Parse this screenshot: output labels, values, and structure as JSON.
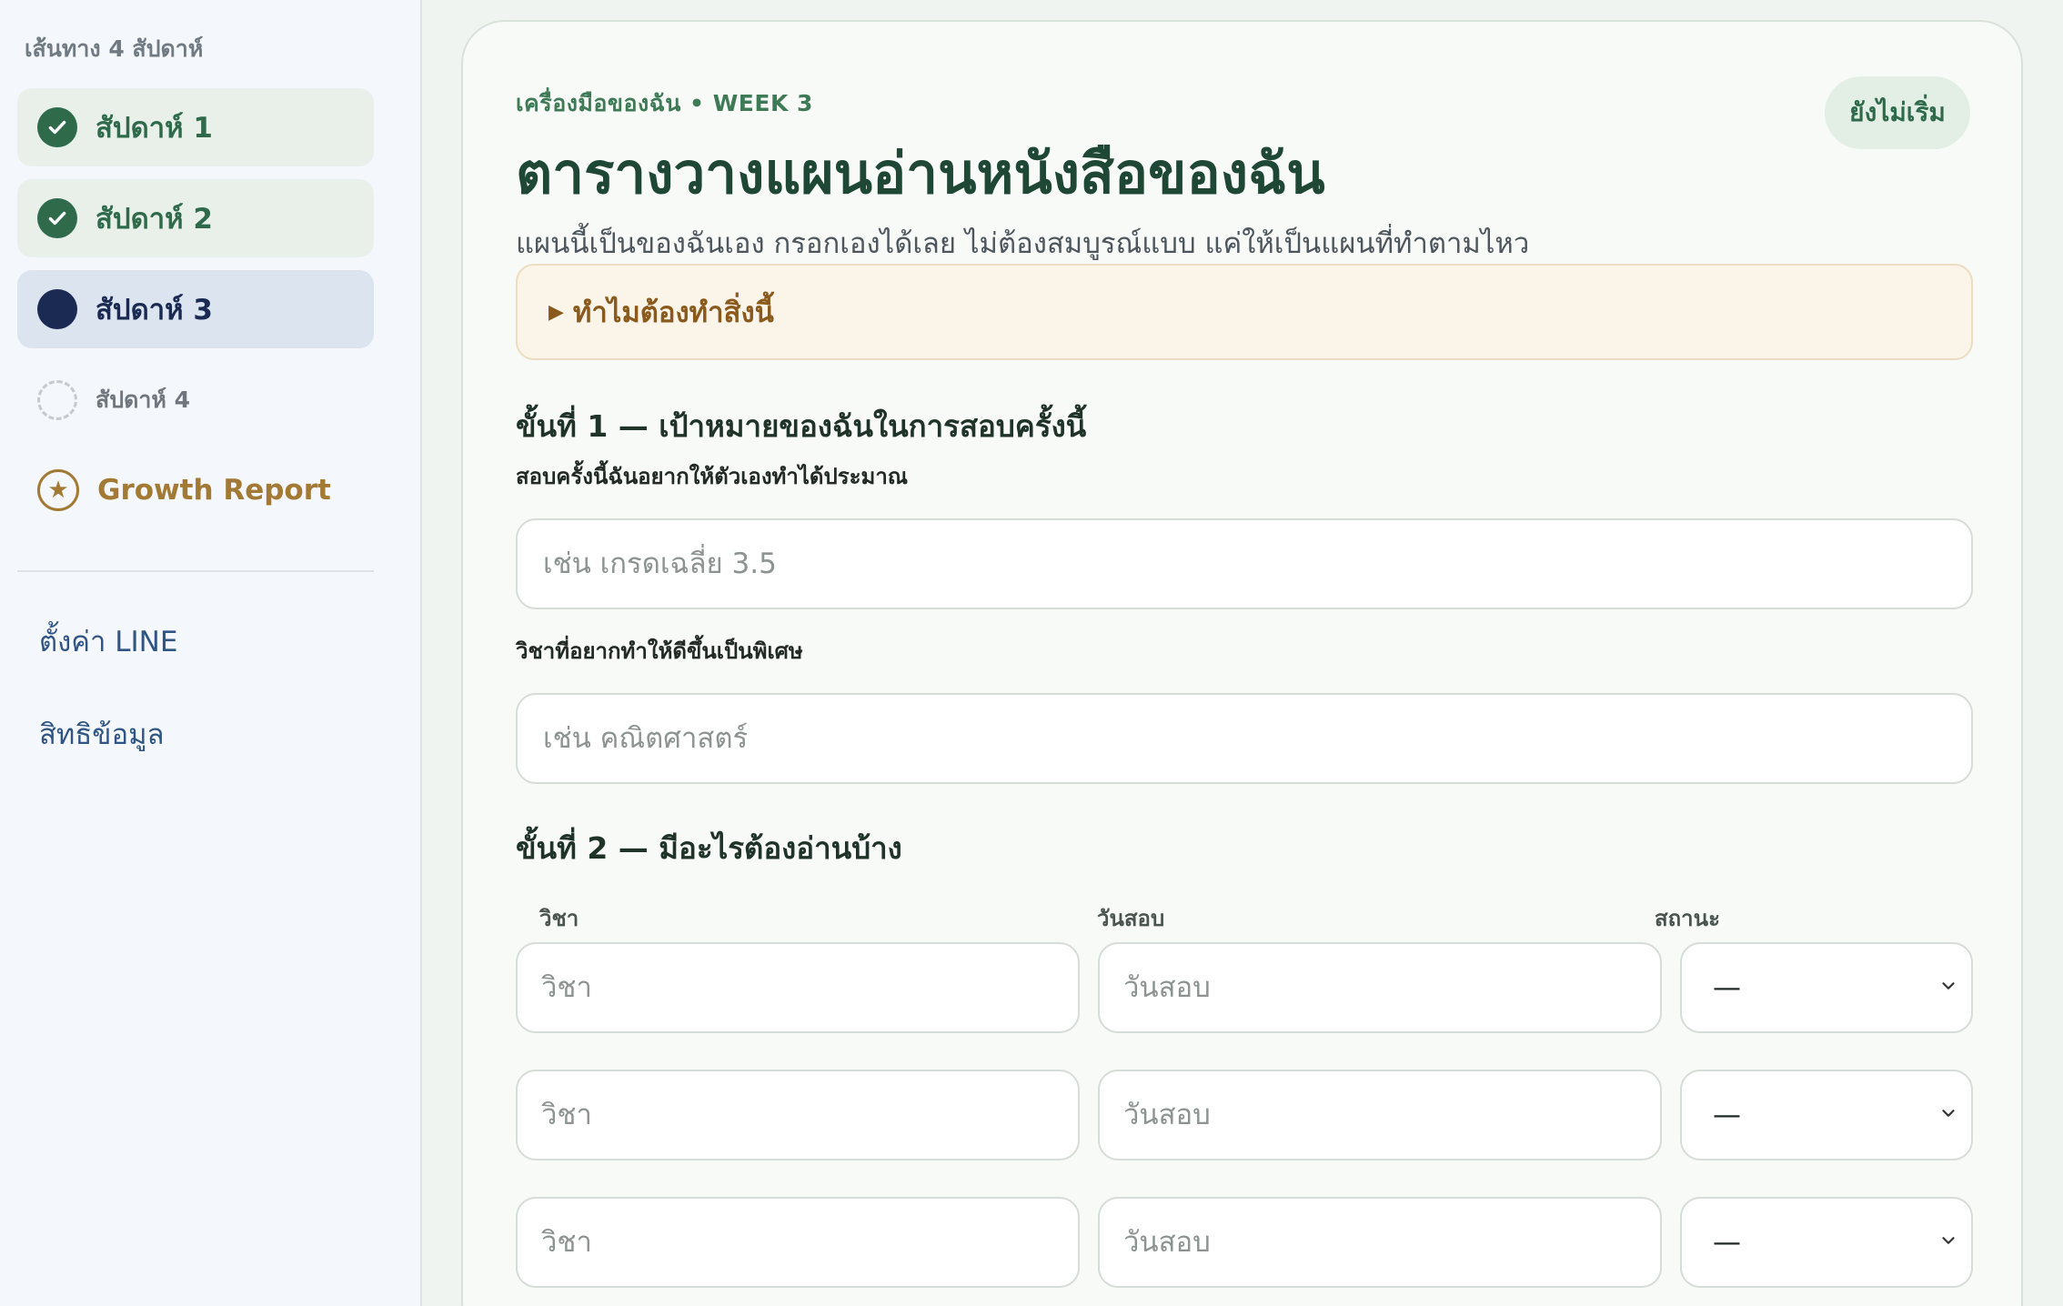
{
  "sidebar": {
    "heading": "เส้นทาง 4 สัปดาห์",
    "weeks": [
      {
        "label": "สัปดาห์ 1",
        "status": "done"
      },
      {
        "label": "สัปดาห์ 2",
        "status": "done"
      },
      {
        "label": "สัปดาห์ 3",
        "status": "current"
      },
      {
        "label": "สัปดาห์ 4",
        "status": "todo"
      }
    ],
    "growth_report": "Growth Report",
    "links": [
      "ตั้งค่า LINE",
      "สิทธิข้อมูล"
    ]
  },
  "card": {
    "kicker": "เครื่องมือของฉัน • WEEK 3",
    "status": "ยังไม่เริ่ม",
    "title": "ตารางวางแผนอ่านหนังสือของฉัน",
    "subtitle": "แผนนี้เป็นของฉันเอง กรอกเองได้เลย ไม่ต้องสมบูรณ์แบบ แค่ให้เป็นแผนที่ทำตามไหว",
    "why_label": "ทำไมต้องทำสิ่งนี้"
  },
  "step1": {
    "title": "ขั้นที่ 1 — เป้าหมายของฉันในการสอบครั้งนี้",
    "goal_label": "สอบครั้งนี้ฉันอยากให้ตัวเองทำได้ประมาณ",
    "goal_placeholder": "เช่น เกรดเฉลี่ย 3.5",
    "subject_label": "วิชาที่อยากทำให้ดีขึ้นเป็นพิเศษ",
    "subject_placeholder": "เช่น คณิตศาสตร์"
  },
  "step2": {
    "title": "ขั้นที่ 2 — มีอะไรต้องอ่านบ้าง",
    "columns": [
      "วิชา",
      "วันสอบ",
      "สถานะ"
    ],
    "rows": [
      {
        "subject_placeholder": "วิชา",
        "date_placeholder": "วันสอบ",
        "status": "—"
      },
      {
        "subject_placeholder": "วิชา",
        "date_placeholder": "วันสอบ",
        "status": "—"
      },
      {
        "subject_placeholder": "วิชา",
        "date_placeholder": "วันสอบ",
        "status": "—"
      }
    ]
  },
  "colors": {
    "green": "#2f6b4b",
    "navy": "#1a2a52",
    "gold": "#a27a34",
    "link": "#2f5584"
  }
}
